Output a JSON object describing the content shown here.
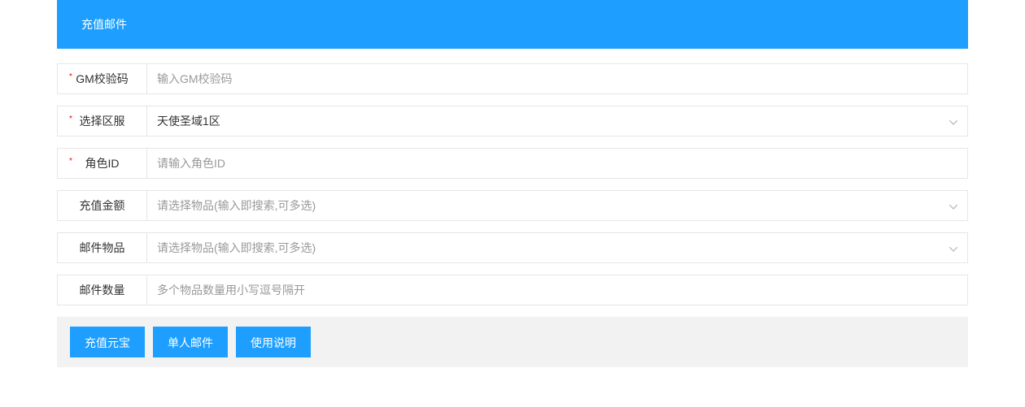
{
  "header": {
    "title": "充值邮件"
  },
  "fields": {
    "gmCode": {
      "label": "GM校验码",
      "placeholder": "输入GM校验码",
      "required": true,
      "value": ""
    },
    "server": {
      "label": "选择区服",
      "value": "天使圣域1区",
      "required": true
    },
    "roleId": {
      "label": "角色ID",
      "placeholder": "请输入角色ID",
      "required": true,
      "value": ""
    },
    "rechargeAmount": {
      "label": "充值金额",
      "placeholder": "请选择物品(输入即搜索,可多选)",
      "required": false
    },
    "mailItems": {
      "label": "邮件物品",
      "placeholder": "请选择物品(输入即搜索,可多选)",
      "required": false
    },
    "mailQuantity": {
      "label": "邮件数量",
      "placeholder": "多个物品数量用小写逗号隔开",
      "required": false,
      "value": ""
    }
  },
  "buttons": {
    "rechargeYuanbao": "充值元宝",
    "singleMail": "单人邮件",
    "usageInstructions": "使用说明"
  }
}
